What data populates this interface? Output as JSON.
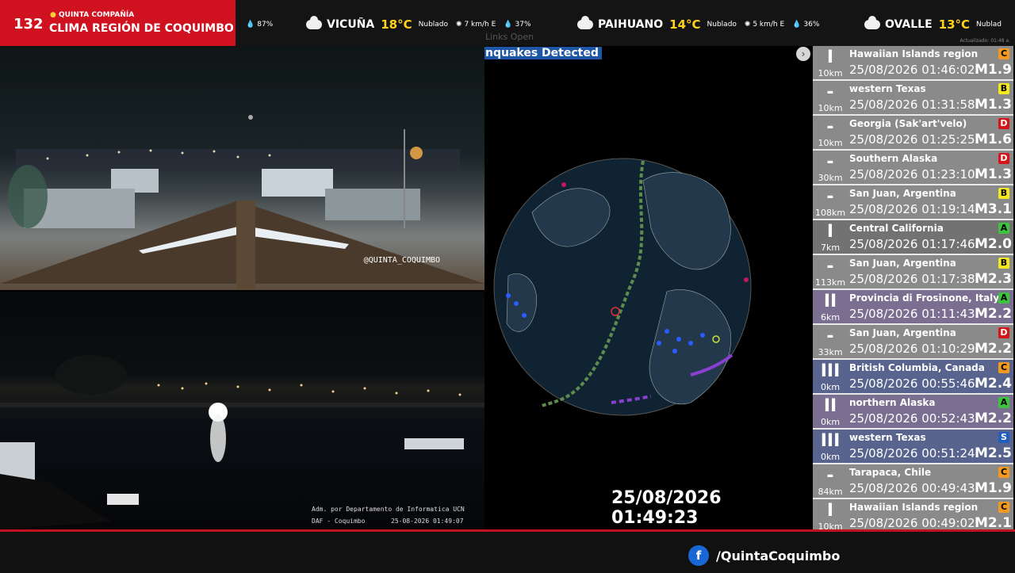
{
  "header": {
    "channel_number": "132",
    "brand_subtitle": "QUINTA COMPAÑÍA",
    "brand_title": "CLIMA REGIÓN DE COQUIMBO",
    "weather": [
      {
        "city": "",
        "temp": "",
        "condition": "",
        "wind": "",
        "humidity": "87%"
      },
      {
        "city": "VICUÑA",
        "temp": "18°C",
        "condition": "Nublado",
        "wind": "7 km/h E",
        "humidity": "37%"
      },
      {
        "city": "PAIHUANO",
        "temp": "14°C",
        "condition": "Nublado",
        "wind": "5 km/h E",
        "humidity": "36%"
      },
      {
        "city": "OVALLE",
        "temp": "13°C",
        "condition": "Nublad",
        "wind": "",
        "humidity": ""
      }
    ],
    "updated": "Actualizado: 01:48 a."
  },
  "links_open": "Links  Open",
  "cams": {
    "cam1_watermark": "@QUINTA_COQUIMBO",
    "cam2_caption_line1": "Adm. por Departamento de Informatica UCN",
    "cam2_caption_line2_left": "DAF - Coquimbo",
    "cam2_caption_line2_right": "25-08-2026 01:49:07"
  },
  "quakes_panel": {
    "label": "nquakes Detected",
    "next_icon": "›",
    "clock": "25/08/2026 01:49:23"
  },
  "quake_list": [
    {
      "bars": "I",
      "depth": "10km",
      "location": "Hawaiian Islands region",
      "time": "25/08/2026 01:46:02",
      "mag": "M1.9",
      "badge": "C",
      "badge_color": "#f39a1e",
      "bg": "#8a8a8a"
    },
    {
      "bars": "-",
      "depth": "10km",
      "location": "western Texas",
      "time": "25/08/2026 01:31:58",
      "mag": "M1.3",
      "badge": "B",
      "badge_color": "#f4e81c",
      "bg": "#8a8a8a"
    },
    {
      "bars": "-",
      "depth": "10km",
      "location": "Georgia (Sak'art'velo)",
      "time": "25/08/2026 01:25:25",
      "mag": "M1.6",
      "badge": "D",
      "badge_color": "#d6151b",
      "bg": "#8a8a8a"
    },
    {
      "bars": "-",
      "depth": "30km",
      "location": "Southern Alaska",
      "time": "25/08/2026 01:23:10",
      "mag": "M1.3",
      "badge": "D",
      "badge_color": "#d6151b",
      "bg": "#8a8a8a"
    },
    {
      "bars": "-",
      "depth": "108km",
      "location": "San Juan, Argentina",
      "time": "25/08/2026 01:19:14",
      "mag": "M3.1",
      "badge": "B",
      "badge_color": "#f4e81c",
      "bg": "#8a8a8a"
    },
    {
      "bars": "I",
      "depth": "7km",
      "location": "Central California",
      "time": "25/08/2026 01:17:46",
      "mag": "M2.0",
      "badge": "A",
      "badge_color": "#3cc43c",
      "bg": "#727272"
    },
    {
      "bars": "-",
      "depth": "113km",
      "location": "San Juan, Argentina",
      "time": "25/08/2026 01:17:38",
      "mag": "M2.3",
      "badge": "B",
      "badge_color": "#f4e81c",
      "bg": "#8a8a8a"
    },
    {
      "bars": "II",
      "depth": "6km",
      "location": "Provincia di Frosinone, Italy",
      "time": "25/08/2026 01:11:43",
      "mag": "M2.2",
      "badge": "A",
      "badge_color": "#3cc43c",
      "bg": "#7b6f91"
    },
    {
      "bars": "-",
      "depth": "33km",
      "location": "San Juan, Argentina",
      "time": "25/08/2026 01:10:29",
      "mag": "M2.2",
      "badge": "D",
      "badge_color": "#d6151b",
      "bg": "#8a8a8a"
    },
    {
      "bars": "III",
      "depth": "0km",
      "location": "British Columbia, Canada",
      "time": "25/08/2026 00:55:46",
      "mag": "M2.4",
      "badge": "C",
      "badge_color": "#f39a1e",
      "bg": "#59648e"
    },
    {
      "bars": "II",
      "depth": "0km",
      "location": "northern Alaska",
      "time": "25/08/2026 00:52:43",
      "mag": "M2.2",
      "badge": "A",
      "badge_color": "#3cc43c",
      "bg": "#7b6f91"
    },
    {
      "bars": "III",
      "depth": "0km",
      "location": "western Texas",
      "time": "25/08/2026 00:51:24",
      "mag": "M2.5",
      "badge": "S",
      "badge_color": "#1f5fbf",
      "bg": "#59648e"
    },
    {
      "bars": "-",
      "depth": "84km",
      "location": "Tarapaca, Chile",
      "time": "25/08/2026 00:49:43",
      "mag": "M1.9",
      "badge": "C",
      "badge_color": "#f39a1e",
      "bg": "#8a8a8a"
    },
    {
      "bars": "I",
      "depth": "10km",
      "location": "Hawaiian Islands region",
      "time": "25/08/2026 00:49:02",
      "mag": "M2.1",
      "badge": "C",
      "badge_color": "#f39a1e",
      "bg": "#8a8a8a"
    }
  ],
  "footer": {
    "fb_icon": "f",
    "handle": "/QuintaCoquimbo"
  }
}
